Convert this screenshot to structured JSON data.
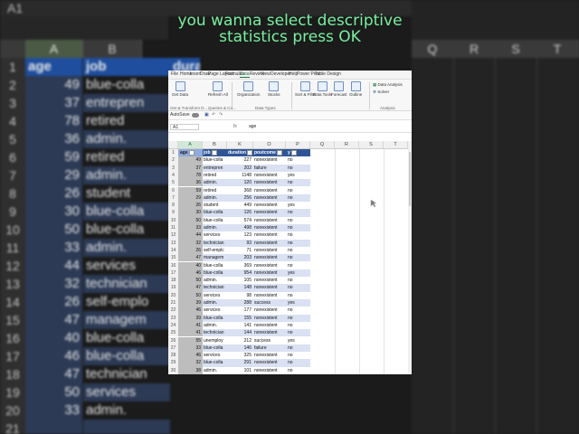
{
  "caption": {
    "line1": "you wanna select descriptive",
    "line2": "statistics press OK"
  },
  "background": {
    "name_box": "A1",
    "columns_left": [
      "A",
      "B"
    ],
    "columns_right": [
      "Q",
      "R",
      "S",
      "T"
    ],
    "header": {
      "age": "age",
      "job": "job",
      "partial": "dura"
    },
    "rows": [
      {
        "n": "1"
      },
      {
        "n": "2",
        "age": "49",
        "job": "blue-colla"
      },
      {
        "n": "3",
        "age": "37",
        "job": "entrepren"
      },
      {
        "n": "4",
        "age": "78",
        "job": "retired"
      },
      {
        "n": "5",
        "age": "36",
        "job": "admin."
      },
      {
        "n": "6",
        "age": "59",
        "job": "retired"
      },
      {
        "n": "7",
        "age": "29",
        "job": "admin."
      },
      {
        "n": "8",
        "age": "26",
        "job": "student"
      },
      {
        "n": "9",
        "age": "30",
        "job": "blue-colla"
      },
      {
        "n": "10",
        "age": "50",
        "job": "blue-colla"
      },
      {
        "n": "11",
        "age": "33",
        "job": "admin."
      },
      {
        "n": "12",
        "age": "44",
        "job": "services"
      },
      {
        "n": "13",
        "age": "32",
        "job": "technician"
      },
      {
        "n": "14",
        "age": "26",
        "job": "self-emplo"
      },
      {
        "n": "15",
        "age": "47",
        "job": "managem"
      },
      {
        "n": "16",
        "age": "40",
        "job": "blue-colla"
      },
      {
        "n": "17",
        "age": "46",
        "job": "blue-colla"
      },
      {
        "n": "18",
        "age": "47",
        "job": "technician"
      },
      {
        "n": "19",
        "age": "50",
        "job": "services"
      },
      {
        "n": "20",
        "age": "33",
        "job": "admin."
      },
      {
        "n": "21"
      }
    ]
  },
  "excel": {
    "menu": [
      "File",
      "Home",
      "Insert",
      "Draw",
      "Page Layout",
      "Formulas",
      "Data",
      "Review",
      "View",
      "Developer",
      "Help",
      "Power Pivot",
      "Table Design"
    ],
    "active_menu": "Data",
    "ribbon": {
      "get_data": "Get Data",
      "refresh_all": "Refresh All",
      "organization": "Organization",
      "stocks": "Stocks",
      "sort_filter": "Sort & Filter",
      "data_tools": "Data Tools",
      "forecast": "Forecast",
      "outline": "Outline",
      "data_analysis": "Data Analysis",
      "solver": "Solver",
      "group_get": "Get & Transform D...",
      "group_queries": "Queries & Co...",
      "group_types": "Data Types",
      "group_analysis": "Analysis"
    },
    "autosave": "AutoSave",
    "name_box": "A1",
    "fx": "fx",
    "formula_value": "age",
    "columns": [
      "A",
      "B",
      "K",
      "O",
      "P",
      "Q",
      "R",
      "S",
      "T"
    ],
    "headers": {
      "age": "age",
      "job": "job",
      "duration": "duration",
      "poutcome": "poutcome",
      "y": "y"
    },
    "rows": [
      {
        "n": "2",
        "age": "49",
        "job": "blue-colla",
        "duration": "227",
        "poutcome": "nonexistent",
        "y": "no"
      },
      {
        "n": "3",
        "age": "37",
        "job": "entrepren",
        "duration": "202",
        "poutcome": "failure",
        "y": "no"
      },
      {
        "n": "4",
        "age": "78",
        "job": "retired",
        "duration": "1148",
        "poutcome": "nonexistent",
        "y": "yes"
      },
      {
        "n": "5",
        "age": "36",
        "job": "admin.",
        "duration": "120",
        "poutcome": "nonexistent",
        "y": "no"
      },
      {
        "n": "6",
        "age": "59",
        "job": "retired",
        "duration": "368",
        "poutcome": "nonexistent",
        "y": "no"
      },
      {
        "n": "7",
        "age": "29",
        "job": "admin.",
        "duration": "256",
        "poutcome": "nonexistent",
        "y": "no"
      },
      {
        "n": "8",
        "age": "26",
        "job": "student",
        "duration": "449",
        "poutcome": "nonexistent",
        "y": "yes"
      },
      {
        "n": "9",
        "age": "30",
        "job": "blue-colla",
        "duration": "126",
        "poutcome": "nonexistent",
        "y": "no"
      },
      {
        "n": "10",
        "age": "50",
        "job": "blue-colla",
        "duration": "574",
        "poutcome": "nonexistent",
        "y": "no"
      },
      {
        "n": "11",
        "age": "33",
        "job": "admin.",
        "duration": "498",
        "poutcome": "nonexistent",
        "y": "no"
      },
      {
        "n": "12",
        "age": "44",
        "job": "services",
        "duration": "123",
        "poutcome": "nonexistent",
        "y": "no"
      },
      {
        "n": "13",
        "age": "32",
        "job": "technician",
        "duration": "93",
        "poutcome": "nonexistent",
        "y": "no"
      },
      {
        "n": "14",
        "age": "26",
        "job": "self-emplc",
        "duration": "71",
        "poutcome": "nonexistent",
        "y": "no"
      },
      {
        "n": "15",
        "age": "47",
        "job": "managem",
        "duration": "203",
        "poutcome": "nonexistent",
        "y": "no"
      },
      {
        "n": "16",
        "age": "40",
        "job": "blue-colla",
        "duration": "369",
        "poutcome": "nonexistent",
        "y": "no"
      },
      {
        "n": "17",
        "age": "46",
        "job": "blue-colla",
        "duration": "954",
        "poutcome": "nonexistent",
        "y": "yes"
      },
      {
        "n": "18",
        "age": "50",
        "job": "admin.",
        "duration": "105",
        "poutcome": "nonexistent",
        "y": "no"
      },
      {
        "n": "19",
        "age": "47",
        "job": "technician",
        "duration": "148",
        "poutcome": "nonexistent",
        "y": "no"
      },
      {
        "n": "20",
        "age": "50",
        "job": "services",
        "duration": "98",
        "poutcome": "nonexistent",
        "y": "no"
      },
      {
        "n": "21",
        "age": "39",
        "job": "admin.",
        "duration": "288",
        "poutcome": "success",
        "y": "yes"
      },
      {
        "n": "22",
        "age": "46",
        "job": "services",
        "duration": "177",
        "poutcome": "nonexistent",
        "y": "no"
      },
      {
        "n": "23",
        "age": "39",
        "job": "blue-colla",
        "duration": "155",
        "poutcome": "nonexistent",
        "y": "no"
      },
      {
        "n": "24",
        "age": "41",
        "job": "admin.",
        "duration": "141",
        "poutcome": "nonexistent",
        "y": "no"
      },
      {
        "n": "25",
        "age": "41",
        "job": "technician",
        "duration": "144",
        "poutcome": "nonexistent",
        "y": "no"
      },
      {
        "n": "26",
        "age": "55",
        "job": "unemploy",
        "duration": "212",
        "poutcome": "success",
        "y": "yes"
      },
      {
        "n": "27",
        "age": "33",
        "job": "blue-colla",
        "duration": "146",
        "poutcome": "failure",
        "y": "no"
      },
      {
        "n": "28",
        "age": "46",
        "job": "services",
        "duration": "325",
        "poutcome": "nonexistent",
        "y": "no"
      },
      {
        "n": "29",
        "age": "32",
        "job": "blue-colla",
        "duration": "291",
        "poutcome": "nonexistent",
        "y": "no"
      },
      {
        "n": "30",
        "age": "38",
        "job": "admin.",
        "duration": "101",
        "poutcome": "nonexistent",
        "y": "no"
      }
    ]
  },
  "colors": {
    "caption": "#78f0a0",
    "table_header": "#2f5597",
    "band": "#d9e1f2",
    "excel_green": "#217346"
  }
}
